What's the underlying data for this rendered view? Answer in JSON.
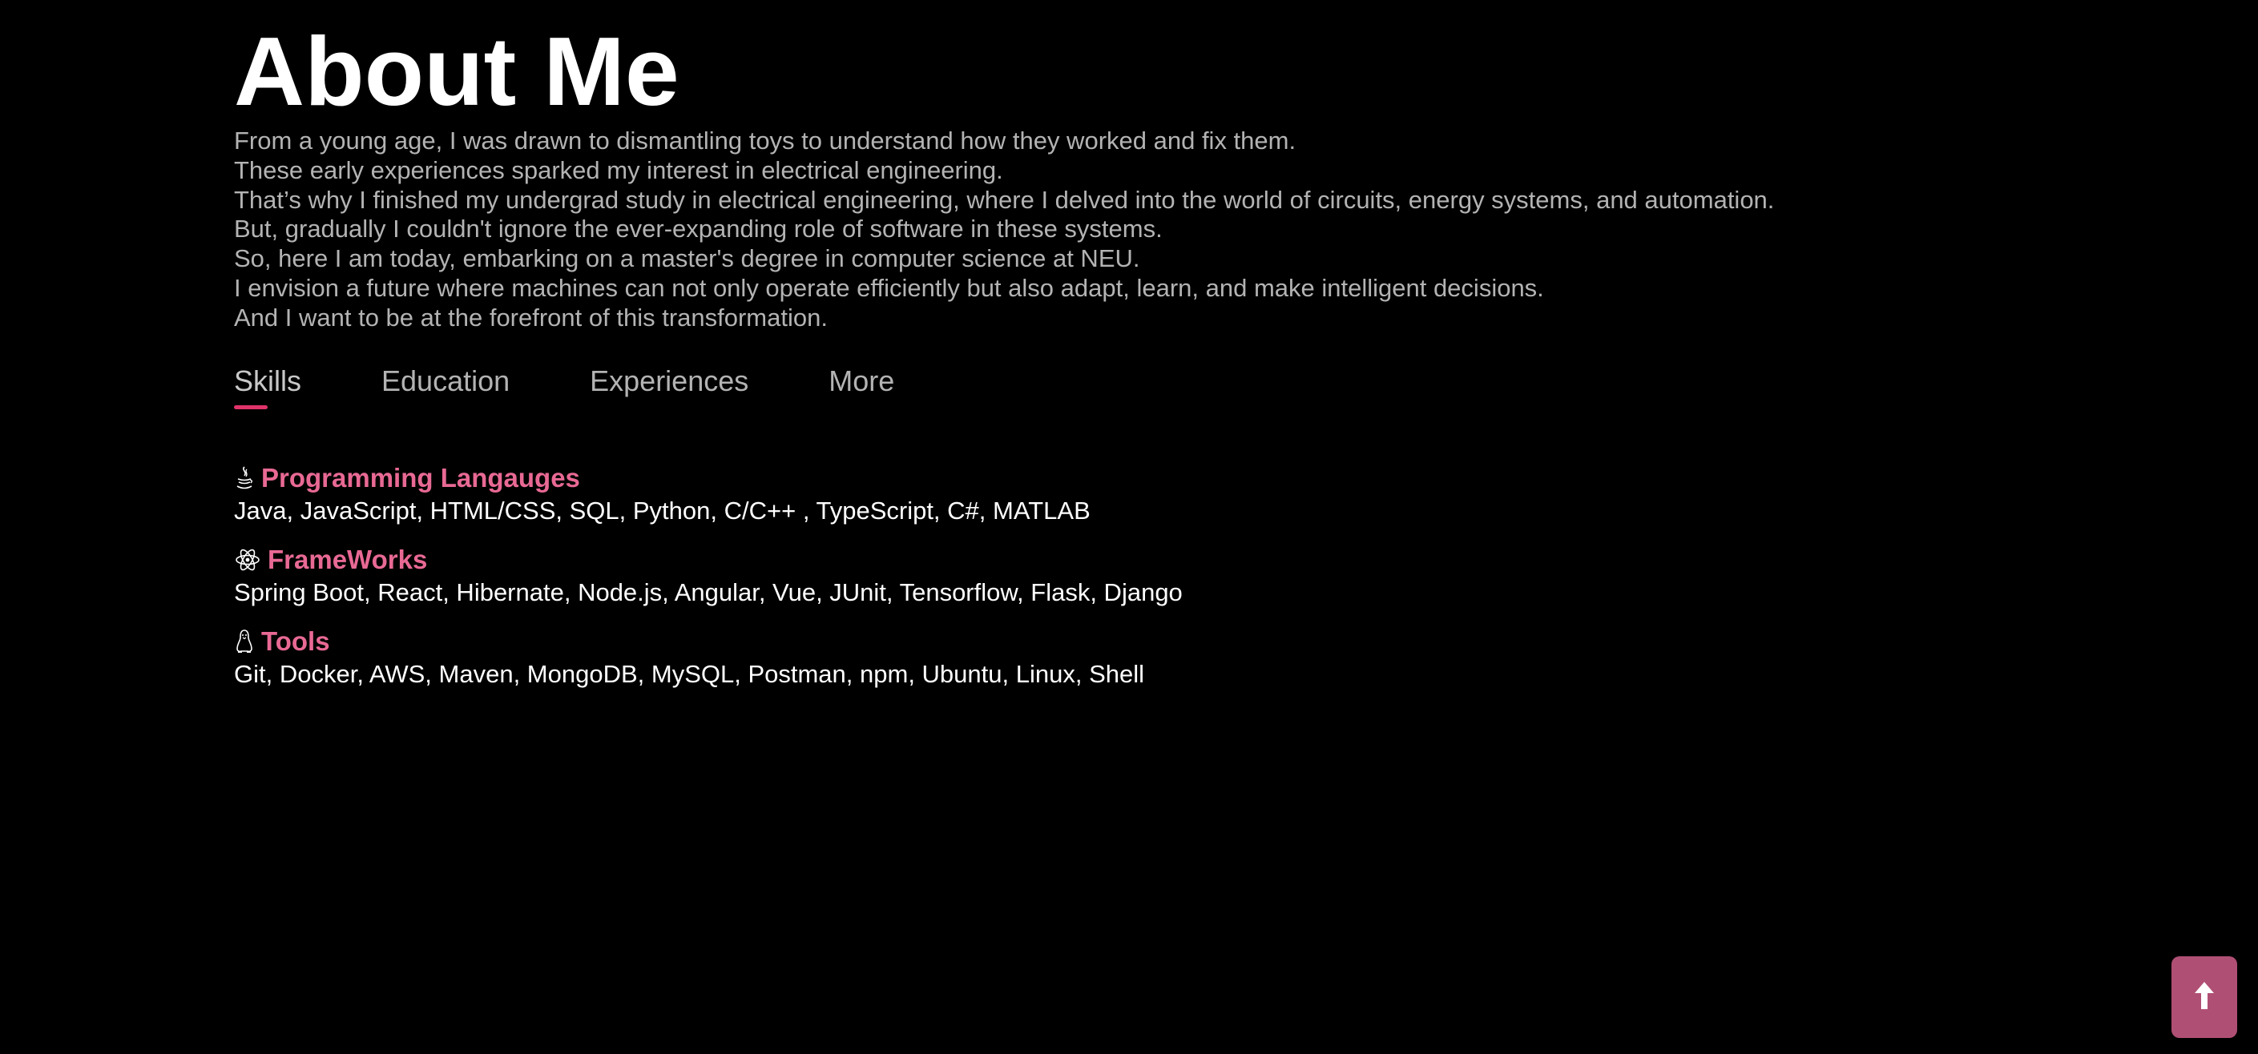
{
  "page": {
    "title": "About Me",
    "intro_lines": [
      "From a young age, I was drawn to dismantling toys to understand how they worked and fix them.",
      "These early experiences sparked my interest in electrical engineering.",
      "That’s why I finished my undergrad study in electrical engineering, where I delved into the world of circuits, energy systems, and automation.",
      "But, gradually I couldn't ignore the ever-expanding role of software in these systems.",
      "So, here I am today, embarking on a master's degree in computer science at NEU.",
      "I envision a future where machines can not only operate efficiently but also adapt, learn, and make intelligent decisions.",
      "And I want to be at the forefront of this transformation."
    ]
  },
  "tabs": [
    {
      "label": "Skills",
      "active": true
    },
    {
      "label": "Education",
      "active": false
    },
    {
      "label": "Experiences",
      "active": false
    },
    {
      "label": "More",
      "active": false
    }
  ],
  "skills": [
    {
      "icon": "java-icon",
      "title": "Programming Langauges",
      "items": "Java, JavaScript, HTML/CSS, SQL, Python, C/C++ , TypeScript, C#, MATLAB"
    },
    {
      "icon": "react-icon",
      "title": "FrameWorks",
      "items": "Spring Boot, React, Hibernate, Node.js, Angular, Vue, JUnit, Tensorflow, Flask, Django"
    },
    {
      "icon": "linux-icon",
      "title": "Tools",
      "items": "Git, Docker, AWS, Maven, MongoDB, MySQL, Postman, npm, Ubuntu, Linux, Shell"
    }
  ],
  "scroll_top": {
    "icon": "arrow-up-icon"
  },
  "colors": {
    "background": "#000000",
    "accent": "#e0336a",
    "skill_title": "#e86994",
    "button": "#b04f74",
    "muted_text": "#b3b3b3"
  }
}
